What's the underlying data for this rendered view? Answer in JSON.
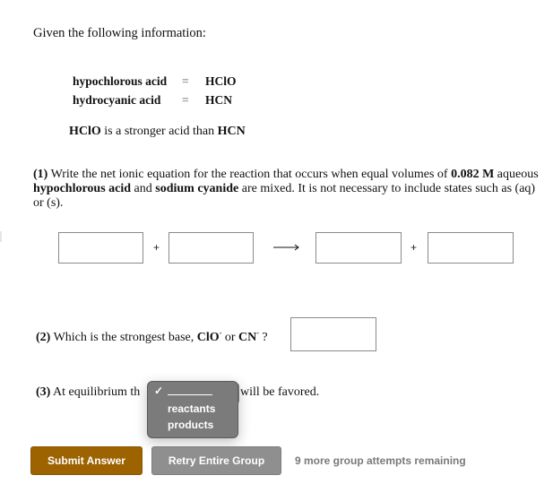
{
  "intro": "Given the following information:",
  "definitions": [
    {
      "name": "hypochlorous acid",
      "eq": "=",
      "formula": "HClO"
    },
    {
      "name": "hydrocyanic acid",
      "eq": "=",
      "formula": "HCN"
    }
  ],
  "statement": {
    "acid1": "HClO",
    "middle": " is a stronger acid than ",
    "acid2": "HCN"
  },
  "question1": {
    "number": "(1)",
    "text_a": " Write the net ionic equation for the reaction that occurs when equal volumes of ",
    "concentration": "0.082 M",
    "text_b": " aqueous ",
    "reagent1": "hypochlorous acid",
    "text_c": " and ",
    "reagent2": "sodium cyanide",
    "text_d": " are mixed. It is not necessary to include states such as (aq) or (s).",
    "plus": "+",
    "inputs": [
      "",
      "",
      "",
      ""
    ]
  },
  "question2": {
    "number": "(2)",
    "text": " Which is the strongest base, ",
    "base1": "ClO",
    "base1_charge": "-",
    "or": " or ",
    "base2": "CN",
    "base2_charge": "-",
    "end": " ?",
    "input": ""
  },
  "question3": {
    "number": "(3)",
    "text_before": " At equilibrium th",
    "text_after": "will be favored.",
    "dropdown": {
      "selected": "________",
      "options": [
        "reactants",
        "products"
      ]
    }
  },
  "buttons": {
    "submit": "Submit Answer",
    "retry": "Retry Entire Group"
  },
  "attempts": "9 more group attempts remaining"
}
